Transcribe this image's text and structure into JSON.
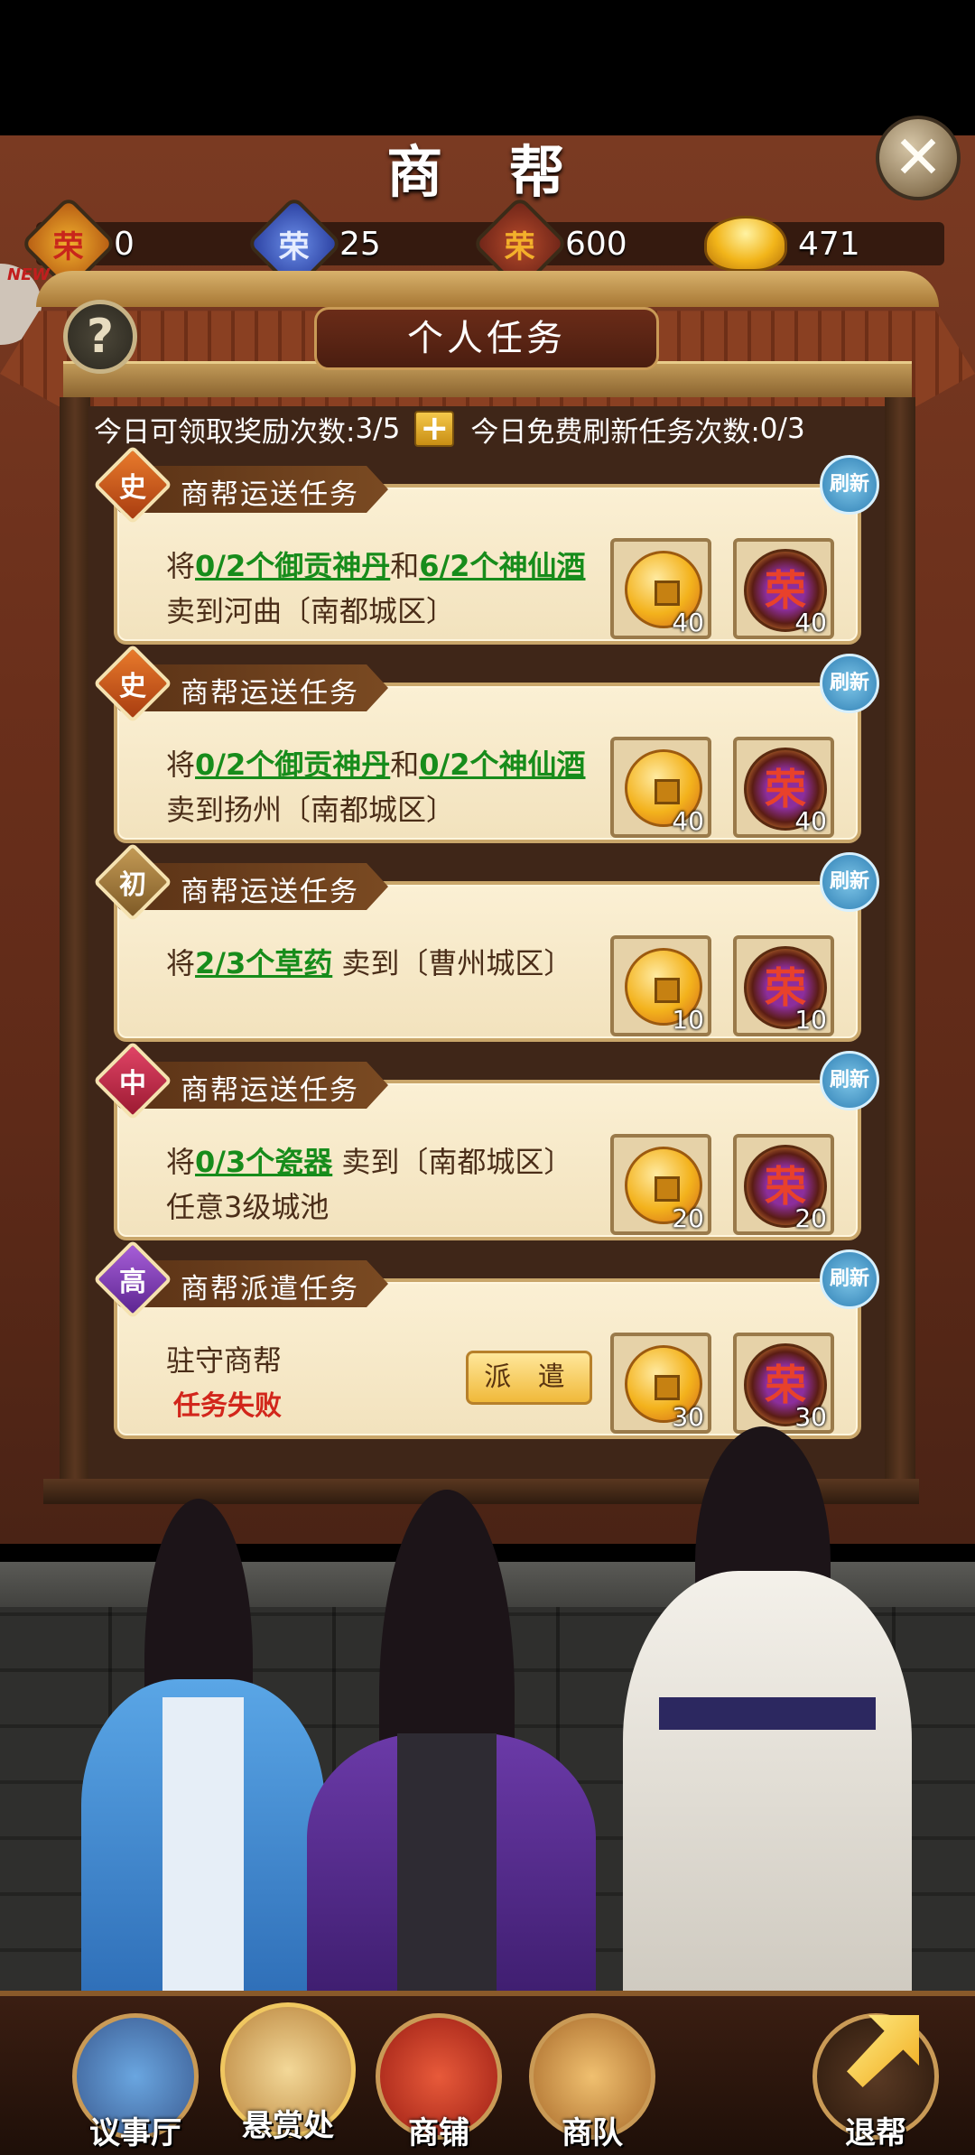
{
  "title": "商 帮",
  "currencies": [
    {
      "icon": "honor-red-icon",
      "glyph": "荣",
      "value": "0"
    },
    {
      "icon": "honor-blue-icon",
      "glyph": "荣",
      "value": "25"
    },
    {
      "icon": "honor-purple-icon",
      "glyph": "荣",
      "value": "600"
    },
    {
      "icon": "gold-ingot-icon",
      "glyph": "",
      "value": "471"
    }
  ],
  "news_label": "NEW",
  "help_glyph": "?",
  "tab_title": "个人任务",
  "info": {
    "reward_label": "今日可领取奖励次数:",
    "reward_value": "3/5",
    "plus": "+",
    "refresh_label": "今日免费刷新任务次数:",
    "refresh_value": "0/3"
  },
  "refresh_label": "刷新",
  "tasks": [
    {
      "rank": "史",
      "title": "商帮运送任务",
      "line1_pre": "将",
      "line1_item1": "0/2个御贡神丹",
      "line1_mid": "和",
      "line1_item2": "6/2个神仙酒",
      "line2": "卖到河曲〔南都城区〕",
      "coin_count": "40",
      "honor_count": "40"
    },
    {
      "rank": "史",
      "title": "商帮运送任务",
      "line1_pre": "将",
      "line1_item1": "0/2个御贡神丹",
      "line1_mid": "和",
      "line1_item2": "0/2个神仙酒",
      "line2": "卖到扬州〔南都城区〕",
      "coin_count": "40",
      "honor_count": "40"
    },
    {
      "rank": "初",
      "title": "商帮运送任务",
      "line1_pre": "将",
      "line1_item1": "2/3个草药",
      "line1_post": " 卖到〔曹州城区〕",
      "coin_count": "10",
      "honor_count": "10"
    },
    {
      "rank": "中",
      "title": "商帮运送任务",
      "line1_pre": "将",
      "line1_item1": "0/3个瓷器",
      "line1_post": " 卖到〔南都城区〕",
      "line2": "任意3级城池",
      "coin_count": "20",
      "honor_count": "20"
    },
    {
      "rank": "高",
      "title": "商帮派遣任务",
      "line1": "驻守商帮",
      "status": "任务失败",
      "dispatch_label": "派 遣",
      "coin_count": "30",
      "honor_count": "30"
    }
  ],
  "honor_glyph": "荣",
  "nav": [
    {
      "label": "议事厅",
      "icon": "council-hall-icon"
    },
    {
      "label": "悬赏处",
      "icon": "bounty-scroll-icon"
    },
    {
      "label": "商铺",
      "icon": "shop-icon"
    },
    {
      "label": "商队",
      "icon": "caravan-icon"
    },
    {
      "label": "退帮",
      "icon": "exit-arrow-icon"
    }
  ],
  "colors": {
    "accent_gold": "#c99a56",
    "progress_green": "#178c1b",
    "fail_red": "#d2261b"
  }
}
